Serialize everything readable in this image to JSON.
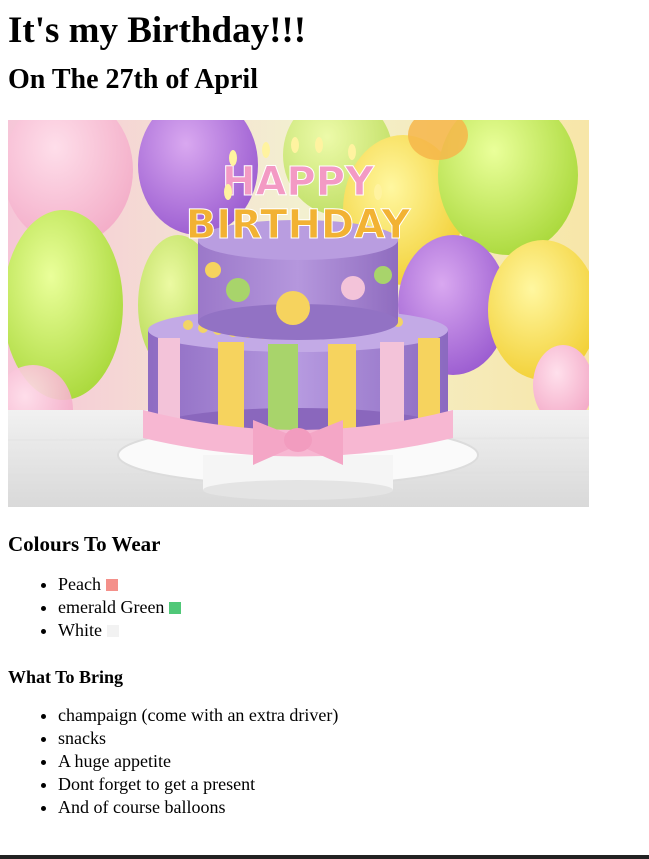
{
  "header": {
    "title": "It's my Birthday!!!",
    "date": "On The 27th of April"
  },
  "image": {
    "cake_topper_text": "HAPPY BIRTHDAY"
  },
  "colours": {
    "heading": "Colours To Wear",
    "items": [
      {
        "label": "Peach",
        "color": "#f4908a"
      },
      {
        "label": "emerald Green",
        "color": "#50c878"
      },
      {
        "label": "White",
        "color": "#f2f2f2"
      }
    ]
  },
  "bring": {
    "heading": "What To Bring",
    "items": [
      "champaign (come with an extra driver)",
      "snacks",
      "A huge appetite",
      "Dont forget to get a present",
      "And of course balloons"
    ]
  }
}
